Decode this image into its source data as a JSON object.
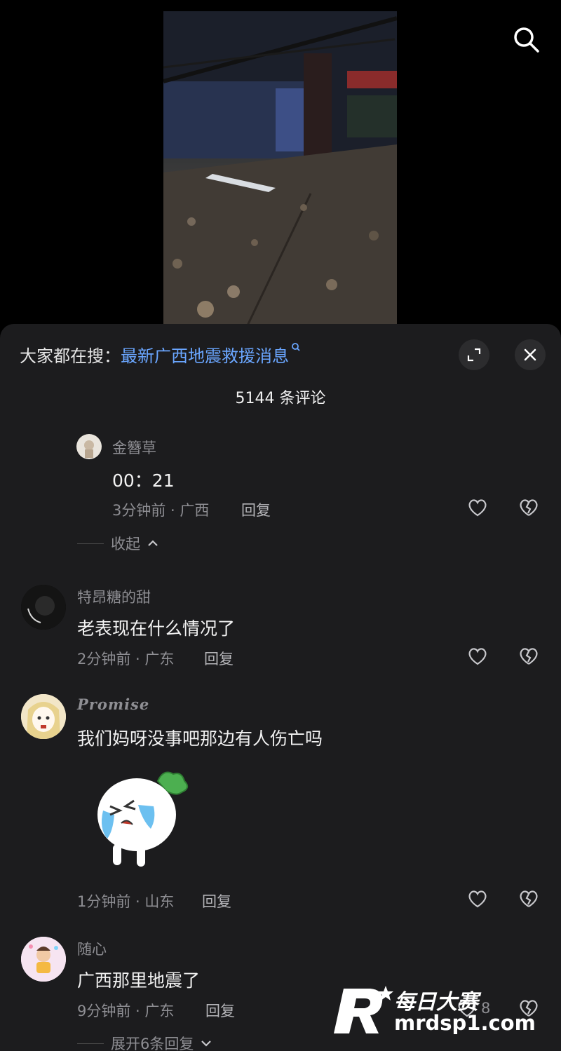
{
  "trending": {
    "prefix": "大家都在搜：",
    "query": "最新广西地震救援消息"
  },
  "comment_count": "5144 条评论",
  "comments": [
    {
      "user": "金簪草",
      "text": "00：21",
      "meta": "3分钟前 · 广西",
      "reply": "回复",
      "collapse": "收起"
    },
    {
      "user": "特昂糖的甜",
      "text": "老表现在什么情况了",
      "meta": "2分钟前 · 广东",
      "reply": "回复"
    },
    {
      "user": "Promise",
      "text": "我们妈呀没事吧那边有人伤亡吗",
      "meta": "1分钟前 · 山东",
      "reply": "回复"
    },
    {
      "user": "随心",
      "text": "广西那里地震了",
      "meta": "9分钟前 · 广东",
      "reply": "回复",
      "likes": "8",
      "expand": "展开6条回复"
    }
  ],
  "watermark": {
    "brand": "每日大赛",
    "site": "mrdsp1.com"
  },
  "colors": {
    "sheet": "#1c1c1e",
    "link": "#6aa6ff",
    "muted": "#8e8e93"
  }
}
